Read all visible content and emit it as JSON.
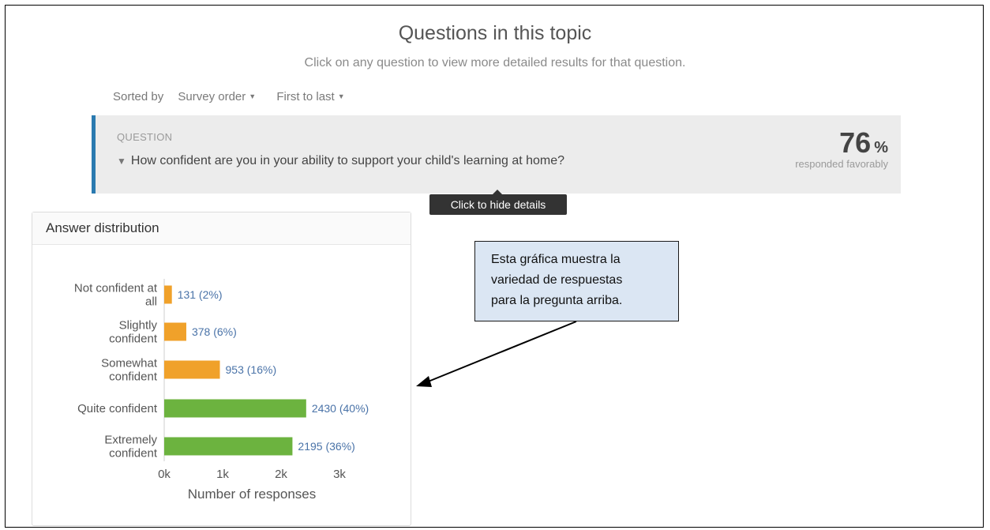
{
  "header": {
    "title": "Questions in this topic",
    "subtitle": "Click on any question to view more detailed results for that question."
  },
  "sort": {
    "label": "Sorted by",
    "order": "Survey order",
    "direction": "First to last"
  },
  "question": {
    "label": "QUESTION",
    "text": "How confident are you in your ability to support your child's learning at home?",
    "percent": "76",
    "percent_sign": "%",
    "percent_caption": "responded favorably"
  },
  "tooltip": "Click to hide details",
  "panel": {
    "title": "Answer distribution"
  },
  "annotation": {
    "line1": "Esta gráfica muestra la",
    "line2": "variedad de respuestas",
    "line3": "para la pregunta arriba."
  },
  "icons": {
    "dropdown": "caret-down-icon",
    "expand": "chevron-down-icon"
  },
  "chart_data": {
    "type": "bar",
    "orientation": "horizontal",
    "categories": [
      [
        "Not confident at",
        "all"
      ],
      [
        "Slightly",
        "confident"
      ],
      [
        "Somewhat",
        "confident"
      ],
      [
        "Quite confident"
      ],
      [
        "Extremely",
        "confident"
      ]
    ],
    "values": [
      131,
      378,
      953,
      2430,
      2195
    ],
    "data_labels": [
      "131 (2%)",
      "378 (6%)",
      "953 (16%)",
      "2430 (40%)",
      "2195 (36%)"
    ],
    "colors": [
      "#f0a12a",
      "#f0a12a",
      "#f0a12a",
      "#6cb33f",
      "#6cb33f"
    ],
    "xlim": [
      0,
      3000
    ],
    "xticks": [
      0,
      1000,
      2000,
      3000
    ],
    "xtick_labels": [
      "0k",
      "1k",
      "2k",
      "3k"
    ],
    "xlabel": "Number of responses",
    "label_color": "#4a73a8"
  }
}
